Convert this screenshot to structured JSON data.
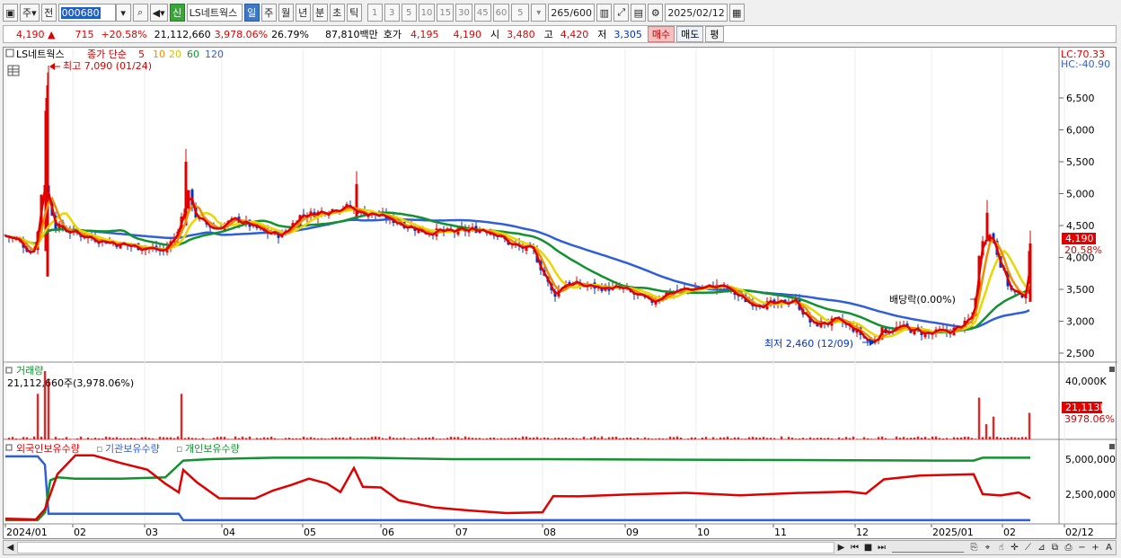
{
  "toolbar": {
    "period_type": "주",
    "compare": "전",
    "code": "000680",
    "stock_badge": "신",
    "stock_name": "LS네트웍스",
    "period_buttons": [
      "일",
      "주",
      "월",
      "년",
      "분",
      "초",
      "틱"
    ],
    "interval_buttons": [
      "1",
      "3",
      "5",
      "10",
      "15",
      "30",
      "45",
      "60"
    ],
    "interval_value": "5",
    "count": "265",
    "count_max": "/600",
    "date": "2025/02/12"
  },
  "info": {
    "price": "4,190",
    "change_arrow": "▲",
    "change": "715",
    "change_rate": "+20.58%",
    "volume": "21,112,660",
    "volume_rate": "3,978.06%",
    "turnover": "26.79%",
    "amount": "87,810백만",
    "quote_label": "호가",
    "ask": "4,195",
    "bid": "4,190",
    "open_label": "시",
    "open": "3,480",
    "high_label": "고",
    "high": "4,420",
    "low_label": "저",
    "low": "3,305",
    "buy_button": "매수",
    "sell_button": "매도",
    "eval_button": "평"
  },
  "price_panel": {
    "legend_name": "LS네트웍스",
    "ma_label": "종가 단순",
    "ma_periods": [
      "5",
      "10",
      "20",
      "60",
      "120"
    ],
    "ma_colors": [
      "#e00000",
      "#f08c00",
      "#e8d800",
      "#11922f",
      "#2f5fd8"
    ],
    "lc": "LC:70.33",
    "hc": "HC:-40.90",
    "y_ticks": [
      "6,500",
      "6,000",
      "5,500",
      "5,000",
      "4,500",
      "4,000",
      "3,500",
      "3,000",
      "2,500"
    ],
    "current_price_tag": "4,190",
    "current_rate_tag": "20.58%",
    "max_annotation": "최고 7,090 (01/24)",
    "min_annotation": "최저 2,460 (12/09)",
    "dividend_annotation": "배당락(0.00%)"
  },
  "volume_panel": {
    "title": "거래량",
    "value_text": "21,112,660주(3,978.06%)",
    "y_tick": "40,000K",
    "volume_tag": "21,113K",
    "rate_tag": "3978.06%"
  },
  "holder_panel": {
    "legend": [
      "외국인보유수량",
      "기관보유수량",
      "개인보유수량"
    ],
    "legend_colors": [
      "#e00000",
      "#2f5fd8",
      "#11922f"
    ],
    "y_ticks": [
      "5,000,000",
      "2,500,000"
    ]
  },
  "x_axis": {
    "labels": [
      "2024/01",
      "02",
      "03",
      "04",
      "05",
      "06",
      "07",
      "08",
      "09",
      "10",
      "11",
      "12",
      "2025/01",
      "02",
      "02/12"
    ]
  },
  "colors": {
    "up": "#e00000",
    "down": "#0033cc",
    "accent": "#3d78c7"
  }
}
